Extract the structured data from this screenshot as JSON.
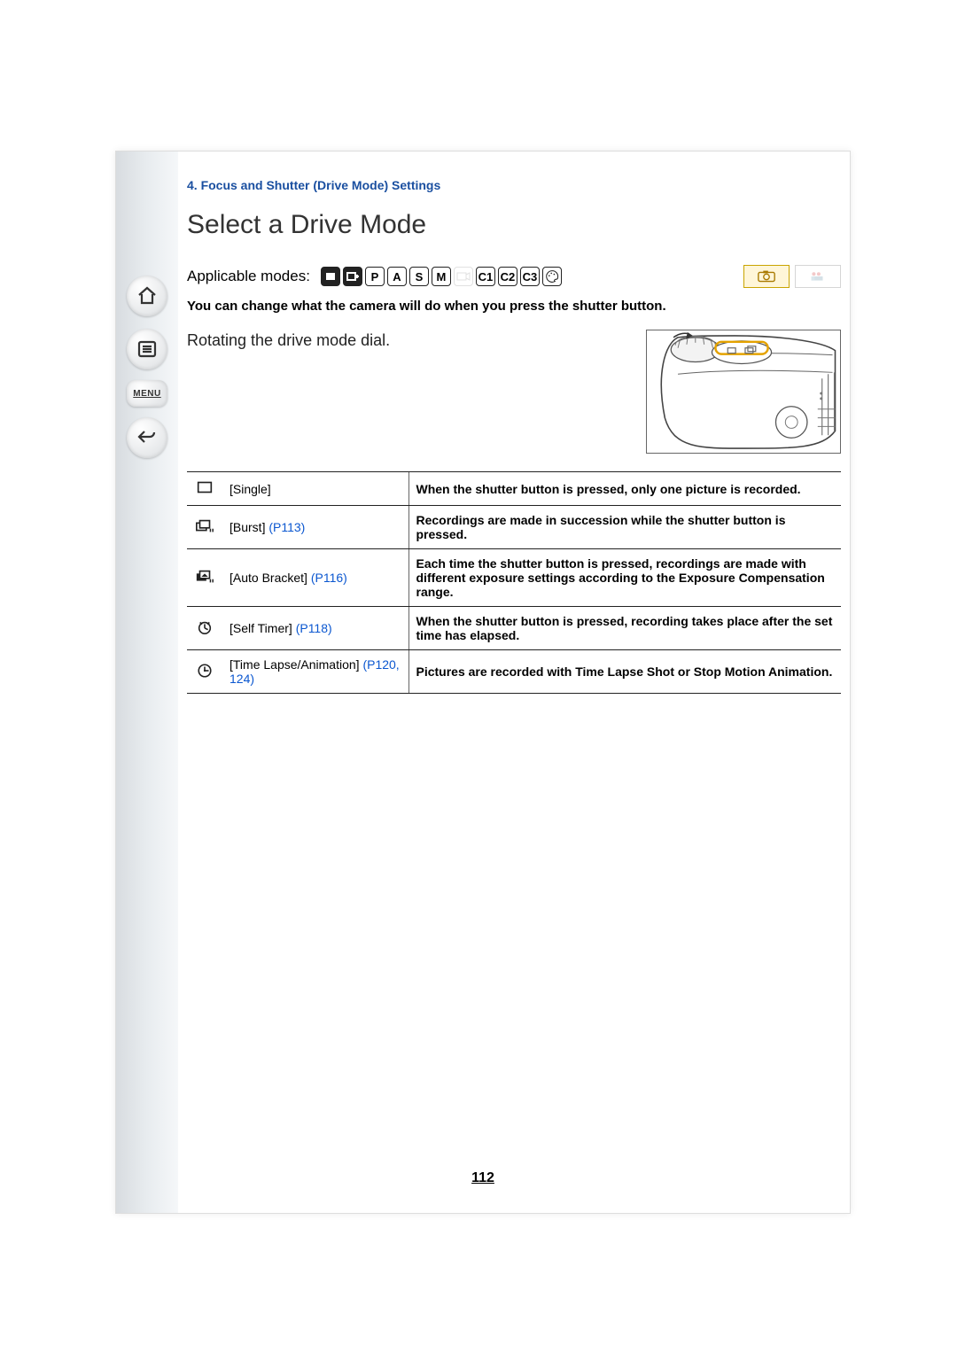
{
  "chapter": "4. Focus and Shutter (Drive Mode) Settings",
  "title": "Select a Drive Mode",
  "applicable_label": "Applicable modes:",
  "modes": [
    "iA",
    "iA+",
    "P",
    "A",
    "S",
    "M",
    "MOV",
    "C1",
    "C2",
    "C3",
    "ART"
  ],
  "intro": "You can change what the camera will do when you press the shutter button.",
  "step": "Rotating the drive mode dial.",
  "nav": {
    "menu_label": "MENU"
  },
  "table": [
    {
      "name": "[Single]",
      "ref": "",
      "desc": "When the shutter button is pressed, only one picture is recorded."
    },
    {
      "name": "[Burst]",
      "ref": "(P113)",
      "desc": "Recordings are made in succession while the shutter button is pressed."
    },
    {
      "name": "[Auto Bracket]",
      "ref": "(P116)",
      "desc": "Each time the shutter button is pressed, recordings are made with different exposure settings according to the Exposure Compensation range."
    },
    {
      "name": "[Self Timer]",
      "ref": "(P118)",
      "desc": "When the shutter button is pressed, recording takes place after the set time has elapsed."
    },
    {
      "name": "[Time Lapse/Animation]",
      "ref": "(P120, 124)",
      "desc": "Pictures are recorded with Time Lapse Shot or Stop Motion Animation."
    }
  ],
  "page_number": "112"
}
